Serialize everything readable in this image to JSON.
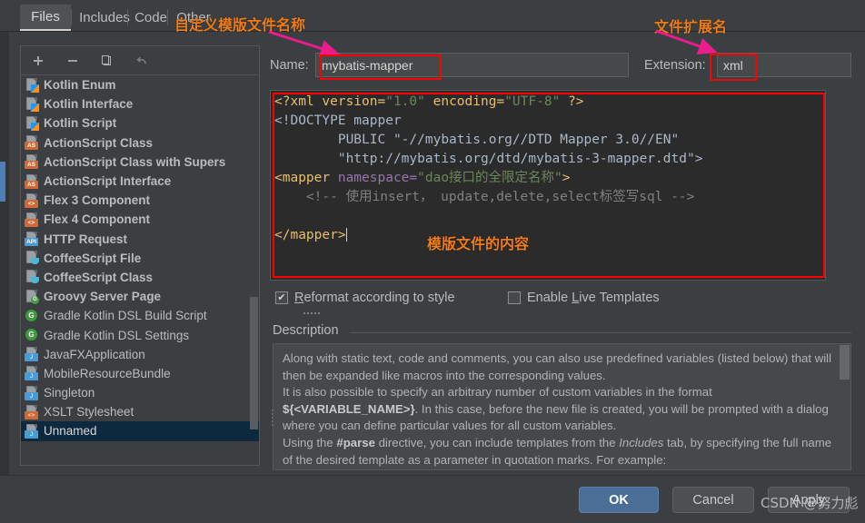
{
  "tabs": [
    {
      "label": "Files",
      "selected": true
    },
    {
      "label": "Includes",
      "selected": false
    },
    {
      "label": "Code",
      "selected": false
    },
    {
      "label": "Other",
      "selected": false
    }
  ],
  "toolbar": {
    "add_label": "+",
    "remove_label": "−",
    "copy_label": "copy-icon",
    "revert_label": "revert-icon"
  },
  "template_list": [
    {
      "label": "Kotlin Enum",
      "icon": "kotlin",
      "bold": true,
      "selected": false
    },
    {
      "label": "Kotlin Interface",
      "icon": "kotlin",
      "bold": true,
      "selected": false
    },
    {
      "label": "Kotlin Script",
      "icon": "kotlin",
      "bold": true,
      "selected": false
    },
    {
      "label": "ActionScript Class",
      "icon": "as",
      "bold": true,
      "selected": false
    },
    {
      "label": "ActionScript Class with Supers",
      "icon": "as",
      "bold": true,
      "selected": false
    },
    {
      "label": "ActionScript Interface",
      "icon": "as",
      "bold": true,
      "selected": false
    },
    {
      "label": "Flex 3 Component",
      "icon": "flex",
      "bold": true,
      "selected": false
    },
    {
      "label": "Flex 4 Component",
      "icon": "flex",
      "bold": true,
      "selected": false
    },
    {
      "label": "HTTP Request",
      "icon": "api",
      "bold": true,
      "selected": false
    },
    {
      "label": "CoffeeScript File",
      "icon": "coffee",
      "bold": true,
      "selected": false
    },
    {
      "label": "CoffeeScript Class",
      "icon": "coffee",
      "bold": true,
      "selected": false
    },
    {
      "label": "Groovy Server Page",
      "icon": "gsp",
      "bold": true,
      "selected": false
    },
    {
      "label": "Gradle Kotlin DSL Build Script",
      "icon": "gradle",
      "bold": false,
      "selected": false
    },
    {
      "label": "Gradle Kotlin DSL Settings",
      "icon": "gradle",
      "bold": false,
      "selected": false
    },
    {
      "label": "JavaFXApplication",
      "icon": "java",
      "bold": false,
      "selected": false
    },
    {
      "label": "MobileResourceBundle",
      "icon": "java",
      "bold": false,
      "selected": false
    },
    {
      "label": "Singleton",
      "icon": "java",
      "bold": false,
      "selected": false
    },
    {
      "label": "XSLT Stylesheet",
      "icon": "flex",
      "bold": false,
      "selected": false
    },
    {
      "label": "Unnamed",
      "icon": "java",
      "bold": false,
      "selected": true
    }
  ],
  "fields": {
    "name_label": "Name:",
    "name_value": "mybatis-mapper",
    "name_placeholder": "",
    "extension_label": "Extension:",
    "extension_value": "xml",
    "extension_placeholder": ""
  },
  "editor": {
    "line1_a": "<?xml version=",
    "line1_b": "\"1.0\"",
    "line1_c": " encoding=",
    "line1_d": "\"UTF-8\"",
    "line1_e": " ?>",
    "line2": "<!DOCTYPE mapper",
    "line3_a": "        PUBLIC ",
    "line3_b": "\"-//mybatis.org//DTD Mapper 3.0//EN\"",
    "line4_a": "        ",
    "line4_b": "\"http://mybatis.org/dtd/mybatis-3-mapper.dtd\"",
    "line4_c": ">",
    "line5_a": "<mapper",
    "line5_b": " namespace=",
    "line5_c": "\"dao接口的全限定名称\"",
    "line5_d": ">",
    "line6": "    <!-- 使用insert， update,delete,select标签写sql -->",
    "line7": "",
    "line8": "</mapper>"
  },
  "checkboxes": {
    "reformat_label_a": "R",
    "reformat_label_b": "eformat according to style",
    "reformat_checked": true,
    "live_label_a": "Enable ",
    "live_label_b": "L",
    "live_label_c": "ive Templates",
    "live_checked": false
  },
  "description": {
    "title": "Description",
    "p1": "Along with static text, code and comments, you can also use predefined variables (listed below) that will then be expanded like macros into the corresponding values.",
    "p2_pre": "It is also possible to specify an arbitrary number of custom variables in the format ",
    "p2_var": "${<VARIABLE_NAME>}",
    "p2_post": ". In this case, before the new file is created, you will be prompted with a dialog where you can define particular values for all custom variables.",
    "p3_pre": "Using the ",
    "p3_parse": "#parse",
    "p3_mid": " directive, you can include templates from the ",
    "p3_includes": "Includes",
    "p3_post": " tab, by specifying the full name of the desired template as a parameter in quotation marks. For example:"
  },
  "buttons": {
    "ok": "OK",
    "cancel": "Cancel",
    "apply": "Apply"
  },
  "annotations": {
    "name_note": "自定义模版文件名称",
    "ext_note": "文件扩展名",
    "content_note": "模版文件的内容"
  },
  "watermark": {
    "text": "CSDN @努力彪"
  },
  "colors": {
    "background": "#3c3f41",
    "editor_background": "#2b2b2b",
    "accent_blue": "#4a6e96",
    "selection": "#0d293e",
    "annotation_orange": "#f07d18",
    "annotation_red": "#fe0000",
    "arrow_pink": "#ec1c8c"
  }
}
